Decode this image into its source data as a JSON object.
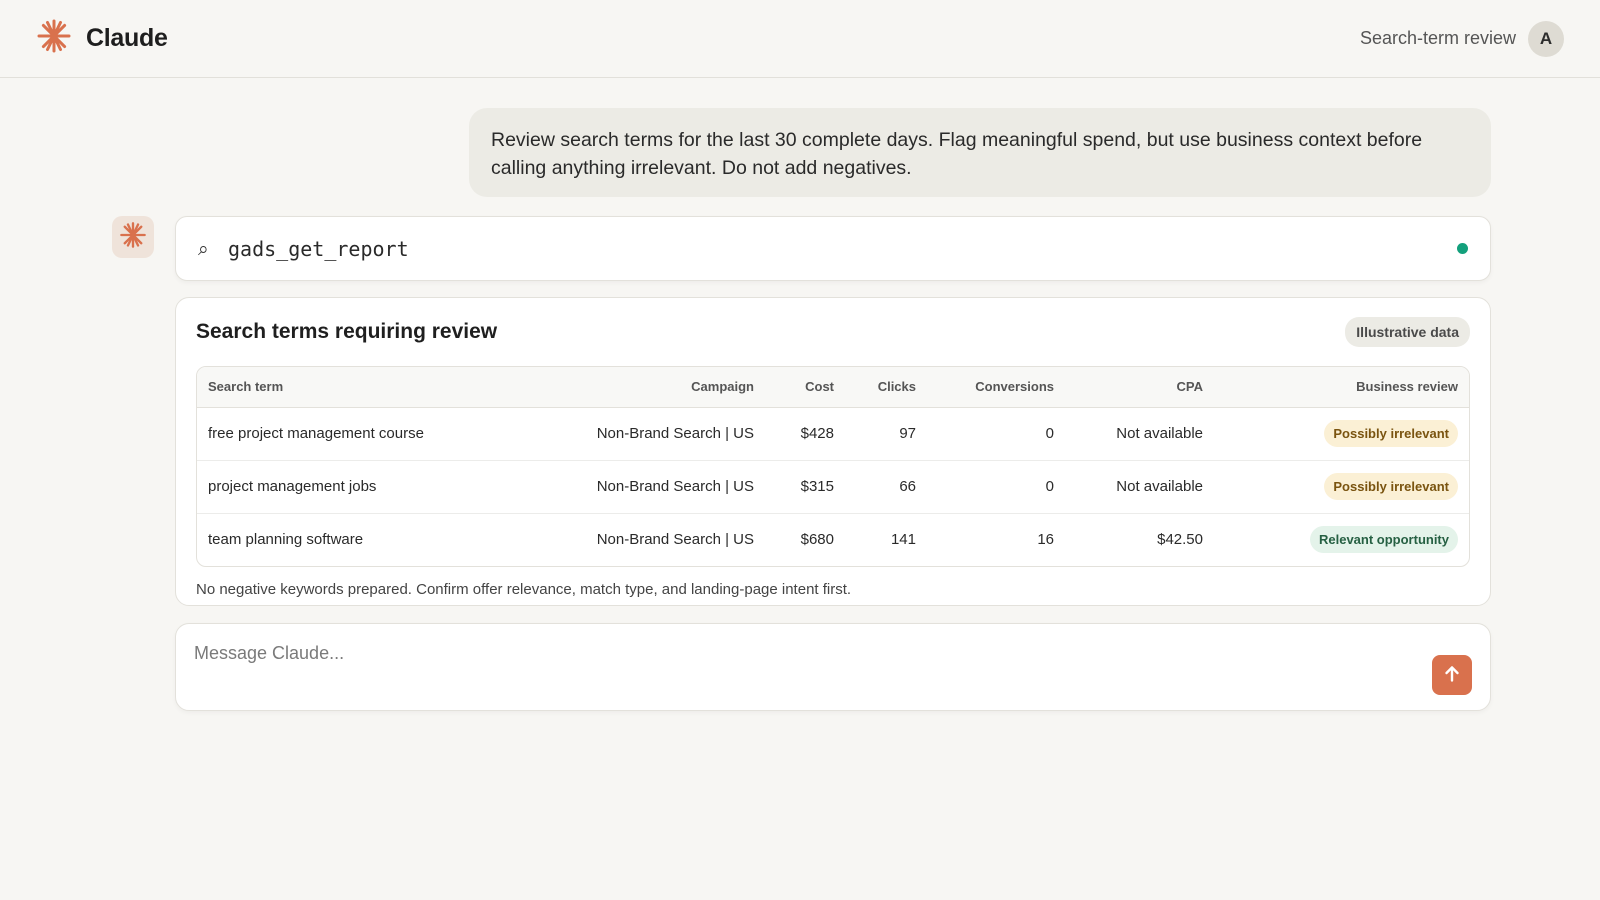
{
  "header": {
    "brand_name": "Claude",
    "brand_icon": "claude-spark-icon",
    "conversation_title": "Search-term review",
    "avatar_initial": "A"
  },
  "colors": {
    "accent": "#d9714d",
    "background": "#f7f6f3",
    "status_ok": "#13a07c"
  },
  "user_message": {
    "text": "Review search terms for the last 30 complete days. Flag meaningful spend, but use business context before calling anything irrelevant. Do not add negatives."
  },
  "tool_call": {
    "icon": "search-icon",
    "icon_glyph": "⌕",
    "name": "gads_get_report",
    "status": "complete"
  },
  "result": {
    "title": "Search terms requiring review",
    "badge": "Illustrative data",
    "columns": [
      "Search term",
      "Campaign",
      "Cost",
      "Clicks",
      "Conversions",
      "CPA",
      "Business review"
    ],
    "rows": [
      {
        "term": "free project management course",
        "campaign": "Non-Brand Search | US",
        "cost": "$428",
        "clicks": "97",
        "conversions": "0",
        "cpa": "Not available",
        "review": "Possibly irrelevant",
        "review_type": "warn"
      },
      {
        "term": "project management jobs",
        "campaign": "Non-Brand Search | US",
        "cost": "$315",
        "clicks": "66",
        "conversions": "0",
        "cpa": "Not available",
        "review": "Possibly irrelevant",
        "review_type": "warn"
      },
      {
        "term": "team planning software",
        "campaign": "Non-Brand Search | US",
        "cost": "$680",
        "clicks": "141",
        "conversions": "16",
        "cpa": "$42.50",
        "review": "Relevant opportunity",
        "review_type": "good"
      }
    ],
    "note": "No negative keywords prepared. Confirm offer relevance, match type, and landing-page intent first."
  },
  "composer": {
    "placeholder": "Message Claude...",
    "send_icon": "arrow-up-icon"
  }
}
